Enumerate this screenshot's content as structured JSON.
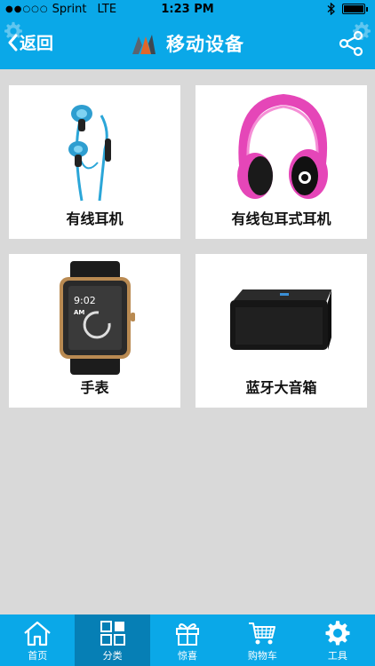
{
  "status_bar": {
    "signal": "●●○○○",
    "carrier": "Sprint",
    "network": "LTE",
    "time": "1:23 PM"
  },
  "nav": {
    "back_label": "返回",
    "title": "移动设备"
  },
  "products": [
    {
      "label": "有线耳机",
      "icon": "wired-earphones"
    },
    {
      "label": "有线包耳式耳机",
      "icon": "over-ear-headphones"
    },
    {
      "label": "手表",
      "icon": "smartwatch",
      "watch_time": "9:02",
      "watch_ampm": "AM"
    },
    {
      "label": "蓝牙大音箱",
      "icon": "bluetooth-speaker"
    }
  ],
  "tabs": [
    {
      "label": "首页",
      "icon": "home-icon"
    },
    {
      "label": "分类",
      "icon": "category-icon",
      "active": true
    },
    {
      "label": "惊喜",
      "icon": "gift-icon"
    },
    {
      "label": "购物车",
      "icon": "cart-icon"
    },
    {
      "label": "工具",
      "icon": "gear-icon"
    }
  ],
  "colors": {
    "primary": "#0aa8e8",
    "active_tab": "#067fb5",
    "background": "#d9d9d9"
  }
}
